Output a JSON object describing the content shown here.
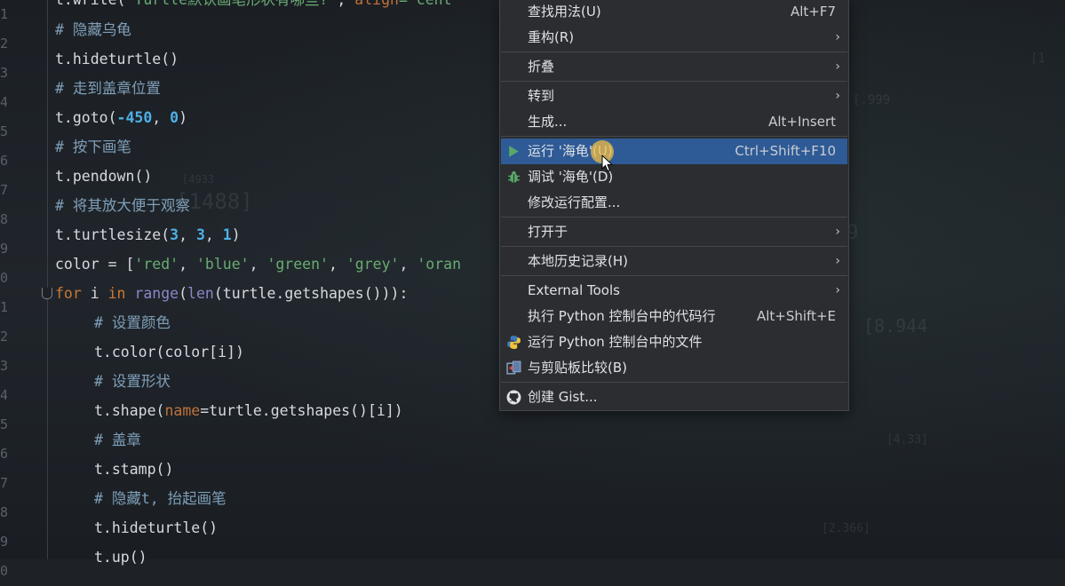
{
  "editor": {
    "line_numbers": [
      "1",
      "2",
      "3",
      "4",
      "5",
      "6",
      "7",
      "8",
      "9",
      "0",
      "1",
      "2",
      "3",
      "4",
      "5",
      "6",
      "7",
      "8",
      "9",
      "0"
    ],
    "lines": {
      "l0": {
        "a": "t.write(",
        "b": "'Turtle默认画笔形状有哪些?'",
        "c": ", ",
        "d": "align",
        "e": "='cent"
      },
      "l1": "# 隐藏乌龟",
      "l2": "t.hideturtle()",
      "l3": "# 走到盖章位置",
      "l4": {
        "a": "t.goto(",
        "b": "-450",
        "c": ", ",
        "d": "0",
        "e": ")"
      },
      "l5": "# 按下画笔",
      "l6": "t.pendown()",
      "l7": "# 将其放大便于观察",
      "l8": {
        "a": "t.turtlesize(",
        "b": "3",
        "c": ", ",
        "d": "3",
        "e": ", ",
        "f": "1",
        "g": ")"
      },
      "l9": {
        "a": "color = [",
        "b": "'red'",
        "c": ", ",
        "d": "'blue'",
        "e": ", ",
        "f": "'green'",
        "g": ", ",
        "h": "'grey'",
        "i": ", ",
        "j": "'oran"
      },
      "l10": {
        "a": "for",
        "b": " i ",
        "c": "in",
        "d": " ",
        "e": "range",
        "f": "(",
        "g": "len",
        "h": "(turtle.getshapes())):"
      },
      "l11": "# 设置颜色",
      "l12": "t.color(color[i])",
      "l13": "# 设置形状",
      "l14": {
        "a": "t.shape(",
        "b": "name",
        "c": "=turtle.getshapes()[i])"
      },
      "l15": "# 盖章",
      "l16": "t.stamp()",
      "l17": "# 隐藏t, 抬起画笔",
      "l18": "t.hideturtle()",
      "l19": "t.up()"
    }
  },
  "menu": {
    "items": [
      {
        "label": "查找用法(U)",
        "shortcut": "Alt+F7"
      },
      {
        "label": "重构(R)",
        "arrow": "›"
      },
      {
        "label": "折叠",
        "arrow": "›"
      },
      {
        "label": "转到",
        "arrow": "›"
      },
      {
        "label": "生成...",
        "shortcut": "Alt+Insert"
      },
      {
        "label": "运行 '海龟'(U)",
        "shortcut": "Ctrl+Shift+F10",
        "icon": "run-icon"
      },
      {
        "label": "调试 '海龟'(D)",
        "icon": "debug-icon"
      },
      {
        "label": "修改运行配置..."
      },
      {
        "label": "打开于",
        "arrow": "›"
      },
      {
        "label": "本地历史记录(H)",
        "arrow": "›"
      },
      {
        "label": "External Tools",
        "arrow": "›"
      },
      {
        "label": "执行 Python 控制台中的代码行",
        "shortcut": "Alt+Shift+E"
      },
      {
        "label": "运行 Python 控制台中的文件",
        "icon": "python-icon"
      },
      {
        "label": "与剪贴板比较(B)",
        "icon": "compare-icon"
      },
      {
        "label": "创建 Gist...",
        "icon": "github-icon"
      }
    ]
  },
  "colors": {
    "selected": "#2e5a96",
    "run_green": "#59a869",
    "comment": "#7f9fb8",
    "number": "#4fb0e6",
    "string": "#6aab73",
    "keyword": "#cc7832"
  }
}
